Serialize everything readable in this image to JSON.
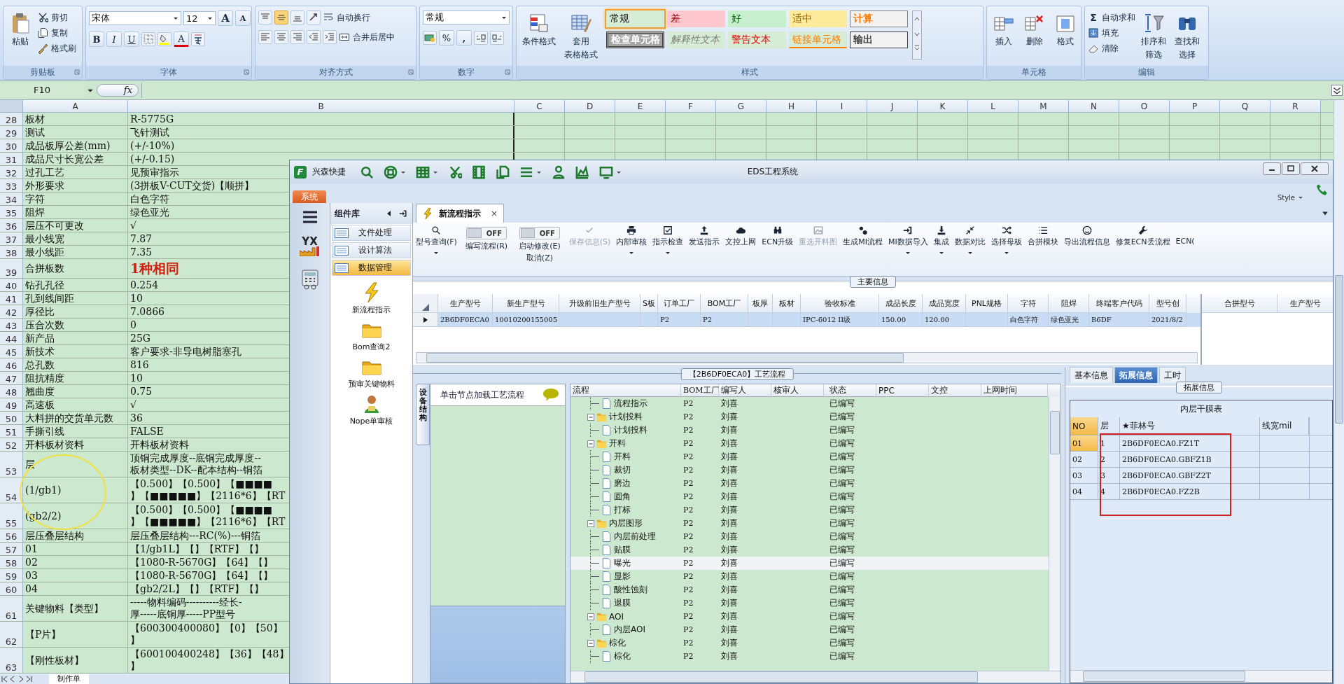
{
  "ribbon": {
    "clipboard": {
      "paste": "粘贴",
      "cut": "剪切",
      "copy": "复制",
      "painter": "格式刷",
      "label": "剪贴板"
    },
    "font": {
      "family": "宋体",
      "size": "12",
      "grow": "A",
      "shrink": "A",
      "bold": "B",
      "italic": "I",
      "underline": "U",
      "color_letter": "A",
      "label": "字体"
    },
    "alignment": {
      "wrap": "自动换行",
      "merge": "合并后居中",
      "label": "对齐方式"
    },
    "number": {
      "format": "常规",
      "percent": "%",
      "comma": ",",
      "label": "数字"
    },
    "styles": {
      "conditional": "条件格式",
      "table_format_1": "套用",
      "table_format_2": "表格格式",
      "label": "样式",
      "cell_styles": [
        {
          "label": "常规",
          "kind": "normal",
          "selected": true
        },
        {
          "label": "差",
          "kind": "bad",
          "selected": false
        },
        {
          "label": "好",
          "kind": "good",
          "selected": false
        },
        {
          "label": "适中",
          "kind": "neutral",
          "selected": false
        },
        {
          "label": "计算",
          "kind": "calc",
          "selected": false
        },
        {
          "label": "检查单元格",
          "kind": "check",
          "selected": false
        },
        {
          "label": "解释性文本",
          "kind": "explanatory",
          "selected": false
        },
        {
          "label": "警告文本",
          "kind": "warning",
          "selected": false
        },
        {
          "label": "链接单元格",
          "kind": "linked",
          "selected": false
        },
        {
          "label": "输出",
          "kind": "output",
          "selected": false
        }
      ]
    },
    "cells": {
      "insert": "插入",
      "delete": "删除",
      "format": "格式",
      "label": "单元格"
    },
    "editing": {
      "sum_sign": "Σ",
      "autosum": "自动求和",
      "fill": "填充",
      "clear": "清除",
      "sort_1": "排序和",
      "sort_2": "筛选",
      "find_1": "查找和",
      "find_2": "选择",
      "label": "编辑"
    }
  },
  "formula_bar": {
    "name_box": "F10",
    "fx": "fx"
  },
  "sheet": {
    "columns": [
      "A",
      "B",
      "C",
      "D",
      "E",
      "F",
      "G",
      "H",
      "I",
      "J",
      "K",
      "L",
      "M",
      "N",
      "O",
      "P",
      "Q",
      "R"
    ],
    "rows": [
      {
        "n": "28",
        "a": "板材",
        "b": "R-5775G"
      },
      {
        "n": "29",
        "a": "测试",
        "b": "飞针测试"
      },
      {
        "n": "30",
        "a": "成品板厚公差(mm)",
        "b": "(+/-10%)"
      },
      {
        "n": "31",
        "a": "成品尺寸长宽公差",
        "b": "(+/-0.15)"
      },
      {
        "n": "32",
        "a": "过孔工艺",
        "b": "见预审指示"
      },
      {
        "n": "33",
        "a": "外形要求",
        "b": "(3拼板V-CUT交货)【顺拼】"
      },
      {
        "n": "34",
        "a": "字符",
        "b": "白色字符"
      },
      {
        "n": "35",
        "a": "阻焊",
        "b": "绿色亚光"
      },
      {
        "n": "36",
        "a": "层压不可更改",
        "b": "√"
      },
      {
        "n": "37",
        "a": "最小线宽",
        "b": "7.87"
      },
      {
        "n": "38",
        "a": "最小线距",
        "b": "7.35"
      },
      {
        "n": "39",
        "a": "合拼板数",
        "b": "1种相同",
        "highlight": true
      },
      {
        "n": "40",
        "a": "钻孔孔径",
        "b": "0.254"
      },
      {
        "n": "41",
        "a": "孔到线间距",
        "b": "10"
      },
      {
        "n": "42",
        "a": "厚径比",
        "b": "7.0866"
      },
      {
        "n": "43",
        "a": "压合次数",
        "b": "0"
      },
      {
        "n": "44",
        "a": "新产品",
        "b": "25G"
      },
      {
        "n": "45",
        "a": "新技术",
        "b": "客户要求-非导电树脂塞孔"
      },
      {
        "n": "46",
        "a": "总孔数",
        "b": "816"
      },
      {
        "n": "47",
        "a": "阻抗精度",
        "b": "10"
      },
      {
        "n": "48",
        "a": "翘曲度",
        "b": "0.75"
      },
      {
        "n": "49",
        "a": "高速板",
        "b": "√"
      },
      {
        "n": "50",
        "a": "大料拼的交货单元数",
        "b": "36"
      },
      {
        "n": "51",
        "a": "手撕引线",
        "b": "FALSE"
      },
      {
        "n": "52",
        "a": "开料板材资料",
        "b": "开料板材资料"
      },
      {
        "n": "53",
        "a": "层",
        "b_lines": [
          "顶铜完成厚度--底铜完成厚度--",
          "板材类型--DK--配本结构--铜箔"
        ]
      },
      {
        "n": "54",
        "a": "(1/gb1)",
        "b_lines": [
          "【0.500】【0.500】【■■■■",
          "】【■■■■■】【2116*6】【RT"
        ]
      },
      {
        "n": "55",
        "a": "(gb2/2)",
        "b_lines": [
          "【0.500】【0.500】【■■■■",
          "】【■■■■■】【2116*6】【RT"
        ]
      },
      {
        "n": "56",
        "a": "层压叠层结构",
        "b": "层压叠层结构---RC(%)---铜箔"
      },
      {
        "n": "57",
        "a": "01",
        "b": "【1/gb1L】【】【RTF】【】"
      },
      {
        "n": "58",
        "a": "02",
        "b": "【1080-R-5670G】【64】【】"
      },
      {
        "n": "59",
        "a": "03",
        "b": "【1080-R-5670G】【64】【】"
      },
      {
        "n": "60",
        "a": "04",
        "b": "【gb2/2L】【】【RTF】【】"
      },
      {
        "n": "61",
        "a": "关键物料【类型】",
        "b_lines": [
          "-----物料编码----------经长-",
          "厚-----底铜厚-----PP型号"
        ]
      },
      {
        "n": "62",
        "a": "【P片】",
        "b_lines": [
          "【600300400080】【0】【50】",
          "】"
        ]
      },
      {
        "n": "63",
        "a": "【刚性板材】",
        "b_lines": [
          "【600100400248】【36】【48】",
          "】"
        ]
      }
    ],
    "tabs": [
      {
        "label": "制作单",
        "selected": true
      }
    ]
  },
  "eds": {
    "logo_text": "F",
    "app_name": "兴森快捷",
    "title": "EDS工程系统",
    "style_menu": "Style",
    "system_tab": "系统",
    "nav_logo_text": "YX",
    "library": {
      "title": "组件库",
      "items": [
        {
          "label": "文件处理",
          "selected": false
        },
        {
          "label": "设计算法",
          "selected": false
        },
        {
          "label": "数据管理",
          "selected": true
        }
      ],
      "tools": [
        {
          "label": "新流程指示"
        },
        {
          "label": "Bom查询2"
        },
        {
          "label": "预审关键物料"
        },
        {
          "label": "Nope单审核"
        }
      ]
    },
    "doc_tab": {
      "label": "新流程指示",
      "close": "×"
    },
    "toolbar": [
      {
        "kind": "button",
        "label": "型号查询(F)",
        "disabled": false,
        "dropdown": true
      },
      {
        "kind": "toggle",
        "label": "编写流程(R)",
        "toggle_text": "OFF",
        "on": false
      },
      {
        "kind": "toggle",
        "label": "启动修改(E)",
        "sublabel": "取消(Z)",
        "toggle_text": "OFF",
        "on": false
      },
      {
        "kind": "button",
        "label": "保存信息(S)",
        "disabled": true,
        "dropdown": false
      },
      {
        "kind": "button",
        "label": "内部审核",
        "disabled": false,
        "dropdown": true
      },
      {
        "kind": "button",
        "label": "指示检查",
        "disabled": false,
        "dropdown": true
      },
      {
        "kind": "button",
        "label": "发送指示",
        "disabled": false,
        "dropdown": false
      },
      {
        "kind": "button",
        "label": "文控上网",
        "disabled": false,
        "dropdown": false
      },
      {
        "kind": "button",
        "label": "ECN升级",
        "disabled": false,
        "dropdown": false
      },
      {
        "kind": "button",
        "label": "重选开料图",
        "disabled": true,
        "dropdown": false
      },
      {
        "kind": "button",
        "label": "生成MI流程",
        "disabled": false,
        "dropdown": false
      },
      {
        "kind": "button",
        "label": "MI数据导入",
        "disabled": false,
        "dropdown": true
      },
      {
        "kind": "button",
        "label": "集成",
        "disabled": false,
        "dropdown": true
      },
      {
        "kind": "button",
        "label": "数据对比",
        "disabled": false,
        "dropdown": true
      },
      {
        "kind": "button",
        "label": "选择母板",
        "disabled": false,
        "dropdown": true
      },
      {
        "kind": "button",
        "label": "合拼模块",
        "disabled": false,
        "dropdown": false
      },
      {
        "kind": "button",
        "label": "导出流程信息",
        "disabled": false,
        "dropdown": false
      },
      {
        "kind": "button",
        "label": "修复ECN丢流程",
        "disabled": false,
        "dropdown": false
      },
      {
        "kind": "button",
        "label": "ECN(",
        "disabled": false,
        "dropdown": false
      }
    ],
    "main_info": {
      "title": "主要信息",
      "columns": [
        "生产型号",
        "新生产型号",
        "升级前旧生产型号",
        "S板",
        "订单工厂",
        "BOM工厂",
        "板厚",
        "板材",
        "验收标准",
        "成品长度",
        "成品宽度",
        "PNL规格",
        "字符",
        "阻焊",
        "终端客户代码",
        "型号创"
      ],
      "rows": [
        {
          "selected": true,
          "cells": [
            "2B6DF0ECA0",
            "10010200155005",
            null,
            null,
            "P2",
            "P2",
            null,
            null,
            "IPC-6012 II级",
            "150.00",
            "120.00",
            null,
            "白色字符",
            "绿色亚光",
            "B6DF",
            "2021/8/2"
          ]
        }
      ],
      "side_columns": [
        "合拼型号",
        "生产型号"
      ]
    },
    "process": {
      "title": "【2B6DF0ECA0】工艺流程",
      "side_tab": "设备结构",
      "hint": "单击节点加载工艺流程",
      "columns": [
        "流程",
        "BOM工厂",
        "编写人",
        "核审人",
        "状态",
        "PPC",
        "文控",
        "上网时间"
      ],
      "tree": [
        {
          "children": [
            {
              "name": "流程指示",
              "kind": "file",
              "selected": false,
              "bom": "P2",
              "writer": "刘喜",
              "status": "已编写"
            }
          ]
        },
        {
          "name": "计划投料",
          "kind": "folder",
          "expanded": true,
          "selected": false,
          "bom": "P2",
          "writer": "刘喜",
          "status": "已编写",
          "children": [
            {
              "name": "计划投料",
              "kind": "file",
              "selected": false,
              "bom": "P2",
              "writer": "刘喜",
              "status": "已编写"
            }
          ]
        },
        {
          "name": "开料",
          "kind": "folder",
          "expanded": true,
          "selected": false,
          "bom": "P2",
          "writer": "刘喜",
          "status": "已编写",
          "children": [
            {
              "name": "开料",
              "kind": "file",
              "selected": false,
              "bom": "P2",
              "writer": "刘喜",
              "status": "已编写"
            },
            {
              "name": "裁切",
              "kind": "file",
              "selected": false,
              "bom": "P2",
              "writer": "刘喜",
              "status": "已编写"
            },
            {
              "name": "磨边",
              "kind": "file",
              "selected": false,
              "bom": "P2",
              "writer": "刘喜",
              "status": "已编写"
            },
            {
              "name": "圆角",
              "kind": "file",
              "selected": false,
              "bom": "P2",
              "writer": "刘喜",
              "status": "已编写"
            },
            {
              "name": "打标",
              "kind": "file",
              "selected": false,
              "bom": "P2",
              "writer": "刘喜",
              "status": "已编写"
            }
          ]
        },
        {
          "name": "内层图形",
          "kind": "folder",
          "expanded": true,
          "selected": false,
          "bom": "P2",
          "writer": "刘喜",
          "status": "已编写",
          "children": [
            {
              "name": "内层前处理",
              "kind": "file",
              "selected": false,
              "bom": "P2",
              "writer": "刘喜",
              "status": "已编写"
            },
            {
              "name": "贴膜",
              "kind": "file",
              "selected": false,
              "bom": "P2",
              "writer": "刘喜",
              "status": "已编写"
            },
            {
              "name": "曝光",
              "kind": "file",
              "selected": true,
              "bom": "P2",
              "writer": "刘喜",
              "status": "已编写"
            },
            {
              "name": "显影",
              "kind": "file",
              "selected": false,
              "bom": "P2",
              "writer": "刘喜",
              "status": "已编写"
            },
            {
              "name": "酸性蚀刻",
              "kind": "file",
              "selected": false,
              "bom": "P2",
              "writer": "刘喜",
              "status": "已编写"
            },
            {
              "name": "退膜",
              "kind": "file",
              "selected": false,
              "bom": "P2",
              "writer": "刘喜",
              "status": "已编写"
            }
          ]
        },
        {
          "name": "AOI",
          "kind": "folder",
          "expanded": true,
          "selected": false,
          "bom": "P2",
          "writer": "刘喜",
          "status": "已编写",
          "children": [
            {
              "name": "内层AOI",
              "kind": "file",
              "selected": false,
              "bom": "P2",
              "writer": "刘喜",
              "status": "已编写"
            }
          ]
        },
        {
          "name": "棕化",
          "kind": "folder",
          "expanded": true,
          "selected": false,
          "bom": "P2",
          "writer": "刘喜",
          "status": "已编写",
          "children": [
            {
              "name": "棕化",
              "kind": "file",
              "selected": false,
              "bom": "P2",
              "writer": "刘喜",
              "status": "已编写"
            }
          ]
        }
      ]
    },
    "detail": {
      "tabs": [
        {
          "label": "基本信息",
          "selected": false
        },
        {
          "label": "拓展信息",
          "selected": true
        },
        {
          "label": "工时",
          "selected": false
        }
      ],
      "group": "拓展信息",
      "table_title": "内层干膜表",
      "columns": [
        "NO",
        "层",
        "★菲林号",
        "线宽mil"
      ],
      "rows": [
        {
          "no": "01",
          "layer": "1",
          "film": "2B6DF0ECA0.FZ1T",
          "selected": true
        },
        {
          "no": "02",
          "layer": "2",
          "film": "2B6DF0ECA0.GBFZ1B",
          "selected": false
        },
        {
          "no": "03",
          "layer": "3",
          "film": "2B6DF0ECA0.GBFZ2T",
          "selected": false
        },
        {
          "no": "04",
          "layer": "4",
          "film": "2B6DF0ECA0.FZ2B",
          "selected": false
        }
      ]
    }
  }
}
